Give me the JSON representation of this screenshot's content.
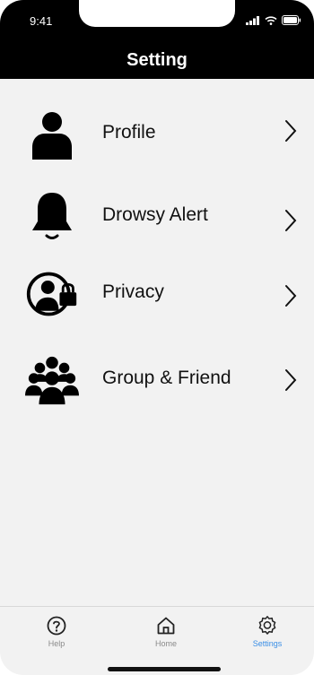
{
  "status_bar": {
    "time": "9:41"
  },
  "header": {
    "title": "Setting"
  },
  "menu": [
    {
      "label": "Profile",
      "icon": "person-icon"
    },
    {
      "label": "Drowsy Alert",
      "icon": "bell-icon"
    },
    {
      "label": "Privacy",
      "icon": "privacy-lock-icon"
    },
    {
      "label": "Group & Friend",
      "icon": "group-icon"
    }
  ],
  "tabbar": {
    "items": [
      {
        "label": "Help",
        "icon": "help-icon",
        "active": false
      },
      {
        "label": "Home",
        "icon": "home-icon",
        "active": false
      },
      {
        "label": "Settings",
        "icon": "gear-icon",
        "active": true
      }
    ]
  },
  "colors": {
    "header_bg": "#000000",
    "content_bg": "#f2f2f2",
    "accent": "#3a8ee6"
  }
}
